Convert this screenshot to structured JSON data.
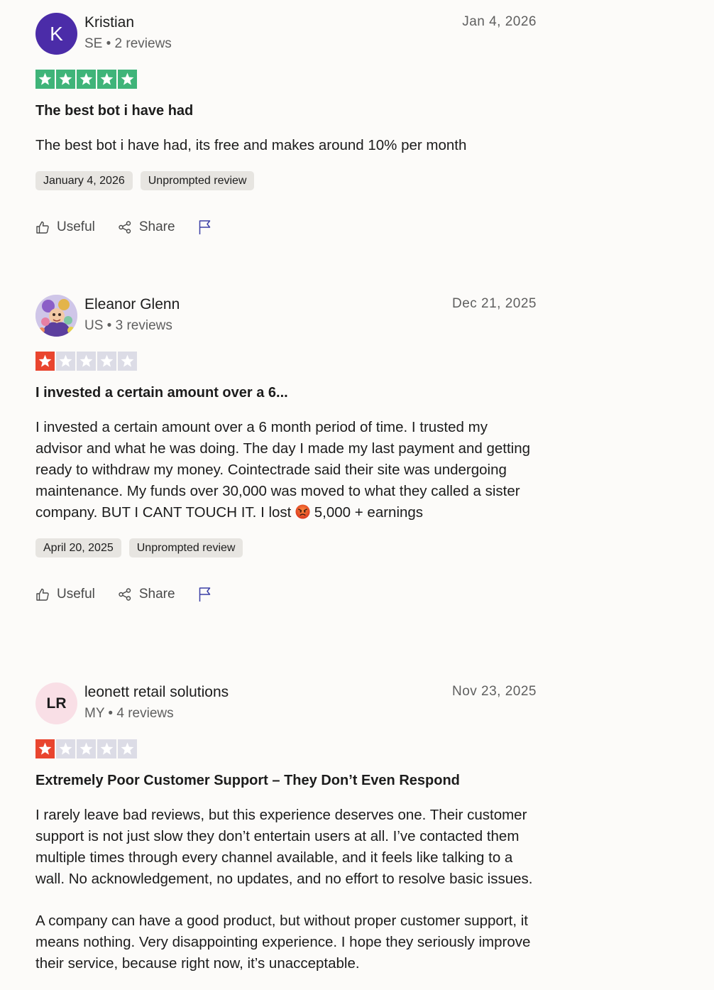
{
  "colors": {
    "star_green": "#3fb479",
    "star_red": "#e9452f",
    "star_empty": "#dcdce6",
    "avatar_k_bg": "#4b2ca8",
    "avatar_lr_bg": "#f9dfe6",
    "tag_bg": "#e7e5e1"
  },
  "actions": {
    "useful_label": "Useful",
    "share_label": "Share"
  },
  "reviews": [
    {
      "name": "Kristian",
      "avatar_initials": "K",
      "country": "SE",
      "review_count": "2 reviews",
      "meta": "SE • 2 reviews",
      "date": "Jan 4, 2026",
      "rating": 5,
      "title": "The best bot i have had",
      "body": [
        "The best bot i have had, its free and makes around 10% per month"
      ],
      "experience_date": "January 4, 2026",
      "tag": "Unprompted review"
    },
    {
      "name": "Eleanor Glenn",
      "avatar_initials": "",
      "avatar_icon": "profile-photo",
      "country": "US",
      "review_count": "3 reviews",
      "meta": "US • 3 reviews",
      "date": "Dec 21, 2025",
      "rating": 1,
      "title": "I invested a certain amount over a 6...",
      "body_before_emoji": "I invested a certain amount over a 6 month period of time. I trusted my advisor and what he was doing. The day I made my last payment and getting ready to withdraw my money. Cointectrade said their site was undergoing maintenance. My funds over 30,000 was moved to what they called a sister company. BUT I CANT TOUCH IT. I lost ",
      "emoji": "angry-face-emoji",
      "body_after_emoji": " 5,000 + earnings",
      "experience_date": "April 20, 2025",
      "tag": "Unprompted review"
    },
    {
      "name": "leonett retail solutions",
      "avatar_initials": "LR",
      "country": "MY",
      "review_count": "4 reviews",
      "meta": "MY • 4 reviews",
      "date": "Nov 23, 2025",
      "rating": 1,
      "title": "Extremely Poor Customer Support – They Don’t Even Respond",
      "body": [
        "I rarely leave bad reviews, but this experience deserves one. Their customer support is not just slow they don’t entertain users at all. I’ve contacted them multiple times through every channel available, and it feels like talking to a wall. No acknowledgement, no updates, and no effort to resolve basic issues.",
        "A company can have a good product, but without proper customer support, it means nothing. Very disappointing experience. I hope they seriously improve their service, because right now, it’s unacceptable."
      ]
    }
  ]
}
